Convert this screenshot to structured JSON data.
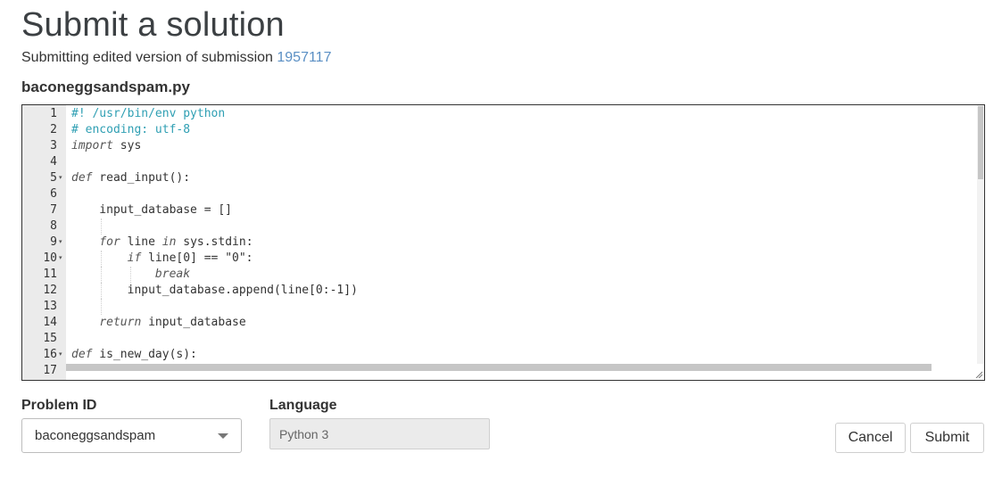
{
  "header": {
    "title": "Submit a solution",
    "subtitle_prefix": "Submitting edited version of submission",
    "submission_id": "1957117"
  },
  "file": {
    "name": "baconeggsandspam.py"
  },
  "editor": {
    "lines": [
      {
        "num": "1",
        "text": "#! /usr/bin/env python"
      },
      {
        "num": "2",
        "text": "# encoding: utf-8"
      },
      {
        "num": "3",
        "text": "import sys"
      },
      {
        "num": "4",
        "text": ""
      },
      {
        "num": "5",
        "text": "def read_input():",
        "fold": true
      },
      {
        "num": "6",
        "text": ""
      },
      {
        "num": "7",
        "text": "    input_database = []"
      },
      {
        "num": "8",
        "text": ""
      },
      {
        "num": "9",
        "text": "    for line in sys.stdin:",
        "fold": true
      },
      {
        "num": "10",
        "text": "        if line[0] == \"0\":",
        "fold": true
      },
      {
        "num": "11",
        "text": "            break"
      },
      {
        "num": "12",
        "text": "        input_database.append(line[0:-1])"
      },
      {
        "num": "13",
        "text": ""
      },
      {
        "num": "14",
        "text": "    return input_database"
      },
      {
        "num": "15",
        "text": ""
      },
      {
        "num": "16",
        "text": "def is_new_day(s):",
        "fold": true
      },
      {
        "num": "17",
        "text": ""
      }
    ]
  },
  "form": {
    "problem_label": "Problem ID",
    "problem_value": "baconeggsandspam",
    "language_label": "Language",
    "language_value": "Python 3"
  },
  "buttons": {
    "cancel": "Cancel",
    "submit": "Submit"
  },
  "colors": {
    "link": "#5a8fc4",
    "comment": "#2f9fb3",
    "gutter": "#ebebeb"
  }
}
